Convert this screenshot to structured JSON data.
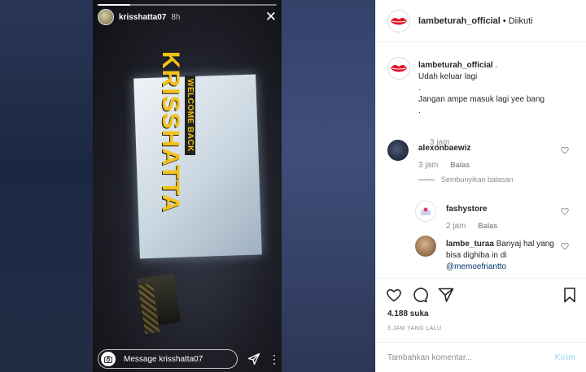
{
  "story": {
    "username": "krisshatta07",
    "time": "8h",
    "close_icon": "close-icon",
    "sign_text_big": "KRISSHATTA",
    "sign_text_small": "WELCOME BACK",
    "message_placeholder": "Message krisshatta07",
    "progress_fraction": 0.18
  },
  "header": {
    "username": "lambeturah_official",
    "separator": "•",
    "follow_status": "Diikuti"
  },
  "caption": {
    "username": "lambeturah_official",
    "lines": [
      "Udah keluar lagi",
      ".",
      "Jangan ampe masuk lagi yee bang",
      "."
    ],
    "time": "3 jam"
  },
  "comments": [
    {
      "username": "alexonbaewiz",
      "text": "",
      "time": "3 jam",
      "reply_label": "Balas",
      "hide_replies_label": "Sembunyikan balasan"
    },
    {
      "username": "fashystore",
      "text": "",
      "time": "2 jam",
      "reply_label": "Balas"
    },
    {
      "username": "lambe_turaa",
      "text": "Banyaj hal yang bisa dighiba in di",
      "mention": "@memoefriantto"
    }
  ],
  "actions": {
    "likes": "4.188 suka",
    "time_ago": "3 JAM YANG LALU",
    "comment_placeholder": "Tambahkan komentar...",
    "post_label": "Kirim"
  },
  "colors": {
    "link": "#003569",
    "muted": "#8e8e8e",
    "post_disabled": "#b2dffc",
    "sign_yellow": "#f3c21a"
  }
}
